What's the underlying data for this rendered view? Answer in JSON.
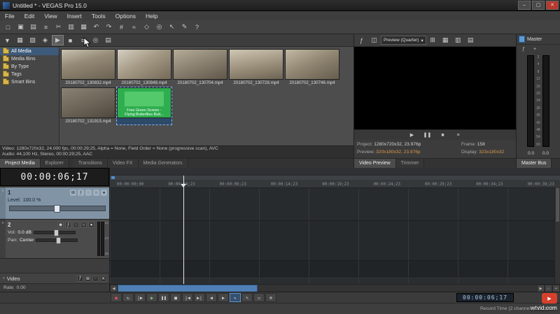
{
  "window": {
    "title": "Untitled * - VEGAS Pro 15.0",
    "minimize": "–",
    "maximize": "▢",
    "close": "✕"
  },
  "menu": {
    "items": [
      "File",
      "Edit",
      "View",
      "Insert",
      "Tools",
      "Options",
      "Help"
    ]
  },
  "main_toolbar": {
    "icons": [
      {
        "n": "new-project-icon",
        "g": "□"
      },
      {
        "n": "open-project-icon",
        "g": "▣"
      },
      {
        "n": "save-project-icon",
        "g": "▤"
      },
      {
        "n": "project-properties-icon",
        "g": "≡"
      },
      {
        "n": "cut-icon",
        "g": "✂"
      },
      {
        "n": "copy-icon",
        "g": "▥"
      },
      {
        "n": "paste-icon",
        "g": "▦"
      },
      {
        "n": "undo-icon",
        "g": "↶"
      },
      {
        "n": "redo-icon",
        "g": "↷"
      },
      {
        "n": "enable-snapping-icon",
        "g": "#"
      },
      {
        "n": "auto-ripple-icon",
        "g": "≈"
      },
      {
        "n": "lock-envelopes-icon",
        "g": "◇"
      },
      {
        "n": "ignore-event-grouping-icon",
        "g": "◎"
      },
      {
        "n": "normal-edit-tool-icon",
        "g": "↖"
      },
      {
        "n": "envelope-edit-tool-icon",
        "g": "✎"
      },
      {
        "n": "interactive-tutorials-icon",
        "g": "?"
      }
    ]
  },
  "media_panel": {
    "toolbar_icons": [
      {
        "n": "import-media-icon",
        "g": "▼"
      },
      {
        "n": "capture-video-icon",
        "g": "▦"
      },
      {
        "n": "get-photo-icon",
        "g": "▧"
      },
      {
        "n": "extract-audio-icon",
        "g": "◈"
      },
      {
        "n": "preview-start-icon",
        "g": "▶",
        "cls": "hl"
      },
      {
        "n": "preview-stop-icon",
        "g": "■"
      },
      {
        "n": "media-properties-icon",
        "g": "≡"
      },
      {
        "n": "media-search-icon",
        "g": "◎"
      },
      {
        "n": "views-icon",
        "g": "▤"
      }
    ],
    "tree": [
      "All Media",
      "Media Bins",
      "By Type",
      "Tags",
      "Smart Bins"
    ],
    "files": [
      {
        "name": "20180702_130832.mp4"
      },
      {
        "name": "20180702_130848.mp4"
      },
      {
        "name": "20180702_130704.mp4"
      },
      {
        "name": "20180702_130728.mp4"
      },
      {
        "name": "20180702_130746.mp4"
      },
      {
        "name": "20180702_131915.mp4"
      }
    ],
    "green_clip": {
      "line1": "Free Green Screen -",
      "line2": "Flying Butterflies Butt..."
    },
    "info_line1": "Video: 1280x720x32, 24.000 fps, 00:00:29;25, Alpha = None, Field Order = None (progressive scan), AVC",
    "info_line2": "Audio: 44,100 Hz, Stereo, 00:00:29;25, AAC",
    "tabs": [
      "Project Media",
      "Explorer"
    ],
    "fx_tabs": [
      "Transitions",
      "Video FX",
      "Media Generators"
    ]
  },
  "preview_panel": {
    "icons_left": [
      {
        "n": "video-output-fx-icon",
        "g": "ƒ"
      },
      {
        "n": "split-screen-view-icon",
        "g": "◫"
      }
    ],
    "quality_label": "Preview (Quarter)",
    "dropdown_arrow": "▾",
    "icons_right": [
      {
        "n": "overlays-icon",
        "g": "⊞"
      },
      {
        "n": "grid-icon",
        "g": "▦"
      },
      {
        "n": "copy-snapshot-icon",
        "g": "▥"
      },
      {
        "n": "save-snapshot-icon",
        "g": "▤"
      }
    ],
    "transport": [
      {
        "n": "preview-play-button",
        "g": "▶"
      },
      {
        "n": "preview-pause-button",
        "g": "❚❚"
      },
      {
        "n": "preview-stop-button",
        "g": "■"
      },
      {
        "n": "preview-loop-button",
        "g": "≡"
      }
    ],
    "info": {
      "project_label": "Project:",
      "project_value": "1280x720x32, 23.976p",
      "frame_label": "Frame:",
      "frame_value": "158",
      "preview_label": "Preview:",
      "preview_value": "320x180x32, 23.976p",
      "display_label": "Display:",
      "display_value": "323x180x32"
    },
    "tabs": [
      "Video Preview",
      "Trimmer"
    ]
  },
  "master_bus": {
    "title": "Master",
    "fx_icons": [
      {
        "n": "master-fx-icon",
        "g": "ƒ"
      },
      {
        "n": "insert-fx-icon",
        "g": "+"
      }
    ],
    "scale": [
      "2",
      "4",
      "8",
      "12",
      "16",
      "20",
      "24",
      "30",
      "36",
      "42",
      "48",
      "54",
      "60"
    ],
    "readout_left": "0.0",
    "readout_right": "0.0",
    "tab": "Master Bus"
  },
  "timeline": {
    "time_display": "00:00:06;17",
    "ruler_labels": [
      "00:00:00;00",
      "00:00:04;23",
      "00:00:09;23",
      "00:00:14;23",
      "00:00:19;23",
      "00:00:24;23",
      "00:00:29;23",
      "00:00:34;23",
      "00:00:39;23"
    ],
    "track1": {
      "number": "1",
      "level_label": "Level:",
      "level_value": "100.0 %",
      "icons": [
        {
          "n": "track-motion-icon",
          "g": "⊞"
        },
        {
          "n": "track-fx-icon",
          "g": "ƒ"
        },
        {
          "n": "mute-icon",
          "g": "◌"
        },
        {
          "n": "solo-icon",
          "g": "○"
        },
        {
          "n": "automation-icon",
          "g": "●"
        }
      ]
    },
    "track2": {
      "number": "2",
      "vol_label": "Vol:",
      "vol_value": "0.0 dB",
      "pan_label": "Pan:",
      "pan_value": "Center",
      "meter_scale": [
        "12",
        "24",
        "48"
      ],
      "icons": [
        {
          "n": "arm-record-icon",
          "g": "◉"
        },
        {
          "n": "track-fx-icon",
          "g": "ƒ"
        },
        {
          "n": "mute-icon",
          "g": "◌"
        },
        {
          "n": "solo-icon",
          "g": "○"
        },
        {
          "n": "automation-icon",
          "g": "●"
        }
      ]
    },
    "video_bus": {
      "label": "Video",
      "icons": [
        {
          "n": "bus-fx-icon",
          "g": "ƒ"
        },
        {
          "n": "bus-motion-icon",
          "g": "⊞"
        },
        {
          "n": "bus-mute-icon",
          "g": "◌"
        },
        {
          "n": "bus-bypass-icon",
          "g": "✕"
        }
      ]
    },
    "rate_label": "Rate:",
    "rate_value": "0.00"
  },
  "transport": {
    "buttons": [
      {
        "n": "record-button",
        "g": "●",
        "cls": "rec"
      },
      {
        "n": "loop-playback-button",
        "g": "↻"
      },
      {
        "n": "play-from-start-button",
        "g": "|▶"
      },
      {
        "n": "play-button",
        "g": "▶",
        "cls": "play"
      },
      {
        "n": "pause-button",
        "g": "❚❚"
      },
      {
        "n": "stop-button",
        "g": "■"
      },
      {
        "n": "go-to-start-button",
        "g": "|◀"
      },
      {
        "n": "go-to-end-button",
        "g": "▶|"
      },
      {
        "n": "previous-frame-button",
        "g": "◀"
      },
      {
        "n": "next-frame-button",
        "g": "▶"
      },
      {
        "n": "normal-edit-tool-button",
        "g": "↖",
        "cls": "active"
      },
      {
        "n": "envelope-edit-tool-button",
        "g": "✎"
      },
      {
        "n": "selection-edit-tool-button",
        "g": "▭"
      },
      {
        "n": "zoom-edit-tool-button",
        "g": "⊕"
      }
    ],
    "timecode": "00:00:06;17"
  },
  "status_bar": {
    "right_text": "Record Time (2 channels): 13:18:09"
  },
  "watermark": {
    "logo_glyph": "▶",
    "text": "wtvid.com"
  }
}
